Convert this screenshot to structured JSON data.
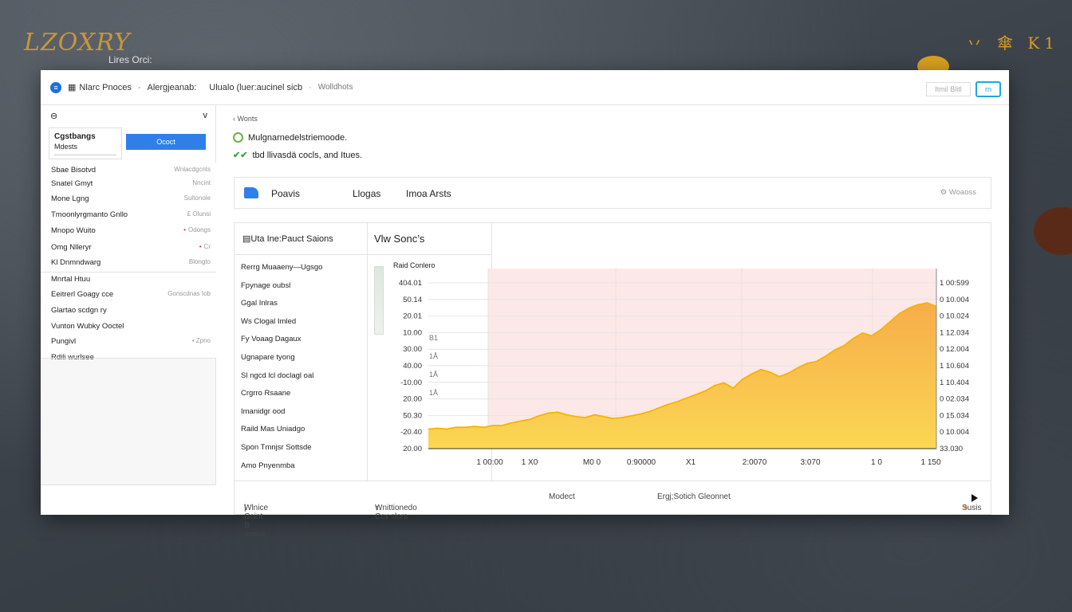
{
  "background": {
    "brand": "LZOXRY",
    "brand_sub": "Lires Orci:",
    "corner_glyphs": "丷 傘 K1"
  },
  "topbar": {
    "crumbs": [
      "Nlarc Pnoces",
      "Alergjeanab:",
      "Ulualo (luer:aucinel sicb",
      "Wolldhots"
    ],
    "ghost_label": "Itmil Blitl",
    "outline_label": "rn"
  },
  "sidebar": {
    "card_title": "Cgstbangs",
    "card_sub": "Mdests",
    "card_button": "Ococt",
    "rows": [
      {
        "label": "Sbae Bisotvd",
        "meta": "Wnlacdgcnts",
        "dot": ""
      },
      {
        "label": "Snatel Gmyt",
        "meta": "Nncint",
        "dot": ""
      },
      {
        "label": "Mone Lgng",
        "meta": "Sultonole",
        "dot": ""
      },
      {
        "label": "Tmoonlyrgmanto Gnllo",
        "meta": "£ Olunsi",
        "dot": ""
      },
      {
        "label": "Mnopo Wuito",
        "meta": "Odongs",
        "dot": "•"
      },
      {
        "label": "Omg Nlleryr",
        "meta": "Cr",
        "dot": "•"
      },
      {
        "label": "Kl Dnmndwarg",
        "meta": "Blongto",
        "dot": ""
      },
      {
        "label": "Mnrtal Htuu",
        "meta": "",
        "dot": ""
      },
      {
        "label": "Eeitrerl Goagy cce",
        "meta": "Gonscdnas Iob",
        "dot": ""
      },
      {
        "label": "Glartao scdgn ry",
        "meta": "",
        "dot": ""
      },
      {
        "label": "Vunton Wubky Ooctel",
        "meta": "",
        "dot": ""
      },
      {
        "label": "Pungivl",
        "meta": "• Zpno",
        "dot": ""
      },
      {
        "label": "Rdili wurlsee",
        "meta": "",
        "dot": ""
      }
    ]
  },
  "main": {
    "breadcrumb": "Wonts",
    "note1": "Mulgnarnedelstriemoode.",
    "note2": "tbd llivasdä cocls, and Itues.",
    "tabs": [
      "Poavis",
      "Llogas",
      "Imoa  Arsts"
    ],
    "tab_right": "Woaoss",
    "col1_title": "Uta Ine:Pauct Saions",
    "col1_rows": [
      "Rerrg Muaaeny—Ugsgo",
      "Fpynage oubsl",
      "Ggal Inlras",
      "Ws Clogal Imled",
      "Fy Voaag Dagaux",
      "Ugnapare tyong",
      "Sl ngcd lcl doclagl oal",
      "Crgrro Rsaane",
      "Imanidgr ood",
      "Raild Mas Uniadgo",
      "Spon Tmnjsr Sottsde",
      "Amo Pnyenmba"
    ],
    "col2_title": "Vlw Sonc’s",
    "col2_sub": "Raid Conlero",
    "bottom": [
      "Wlnice Gsint B scooe",
      "Wnittionedo Ccx slors",
      "Modect",
      "Ergj;Sotich Gleonnet",
      "Susis"
    ]
  },
  "chart_data": {
    "type": "area",
    "ylabels": [
      "404.01",
      "50.14",
      "20.01",
      "10.00",
      "30.00",
      "40.00",
      "-10.00",
      "20.00",
      "50.30",
      "-20.40",
      "20.00"
    ],
    "right_labels": [
      "1 00:599",
      "0 10.004",
      "0 10.024",
      "1 12.034",
      "0 12.004",
      "1 10.604",
      "1 10.404",
      "0 02.034",
      "0 15.034",
      "0 10.004",
      "33.030"
    ],
    "xlabels": [
      "1 00:00",
      "1 X0",
      "M0  0",
      "0:90000",
      "X1",
      "2:0070",
      "3:070",
      "1 0",
      "1 150"
    ],
    "side_marks": [
      "1Å",
      "1Å",
      "1Å",
      "B1"
    ],
    "values": [
      0.22,
      0.23,
      0.22,
      0.24,
      0.24,
      0.25,
      0.24,
      0.26,
      0.26,
      0.29,
      0.31,
      0.33,
      0.37,
      0.4,
      0.41,
      0.38,
      0.36,
      0.35,
      0.38,
      0.36,
      0.34,
      0.35,
      0.37,
      0.39,
      0.42,
      0.46,
      0.5,
      0.53,
      0.57,
      0.61,
      0.65,
      0.71,
      0.74,
      0.68,
      0.78,
      0.84,
      0.89,
      0.86,
      0.81,
      0.85,
      0.91,
      0.96,
      0.98,
      1.04,
      1.11,
      1.16,
      1.24,
      1.3,
      1.27,
      1.34,
      1.43,
      1.52,
      1.58,
      1.62,
      1.64,
      1.6
    ],
    "ylim": [
      0,
      2
    ],
    "shaded_band": true,
    "colors": {
      "fill_top": "#f7ad4a",
      "fill_bottom": "#fbd753",
      "band": "#fde8e8",
      "line": "#f5b400"
    }
  }
}
